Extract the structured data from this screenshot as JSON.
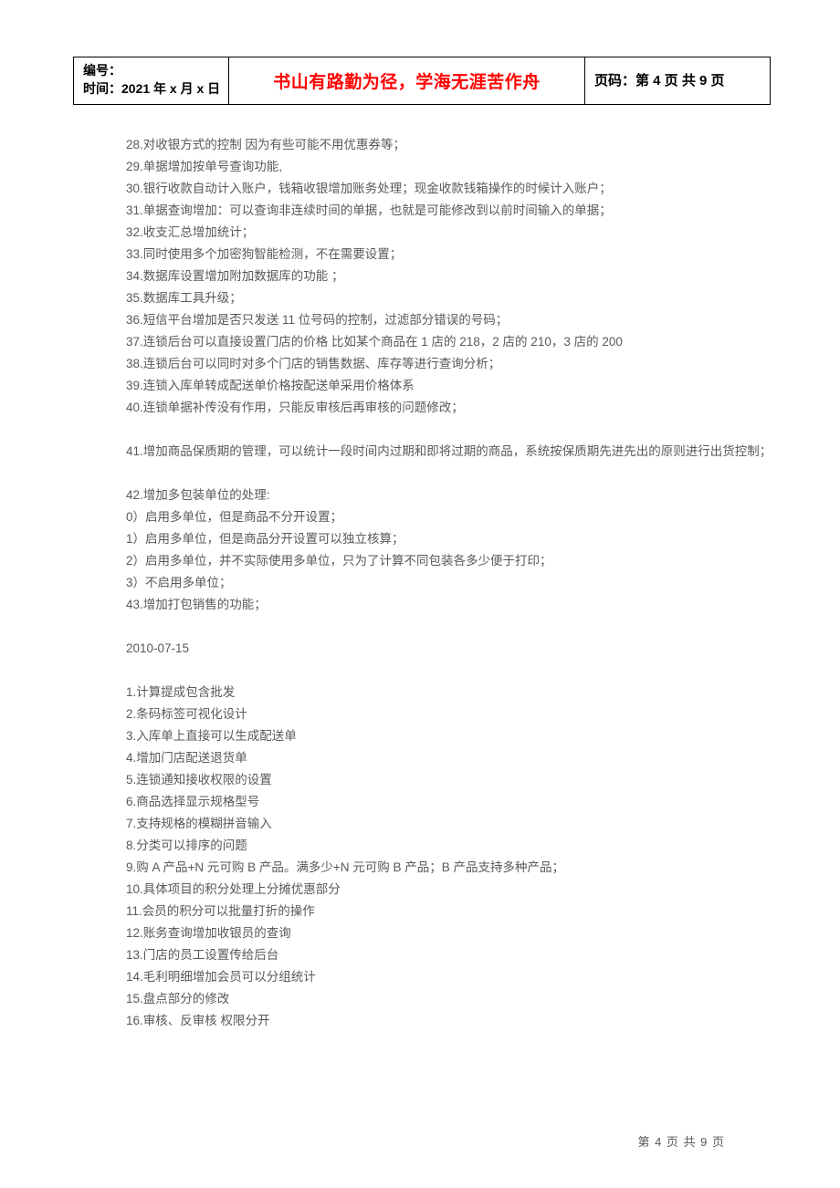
{
  "header": {
    "left_line1": "编号：",
    "left_line2": "时间：2021 年 x 月 x 日",
    "center": "书山有路勤为径，学海无涯苦作舟",
    "right": "页码：第 4 页  共 9 页"
  },
  "sections": [
    {
      "lines": [
        "28.对收银方式的控制  因为有些可能不用优惠券等；",
        "29.单据增加按单号查询功能,",
        "30.银行收款自动计入账户，钱箱收银增加账务处理；现金收款钱箱操作的时候计入账户；",
        "31.单据查询增加：可以查询非连续时间的单据，也就是可能修改到以前时间输入的单据；",
        "32.收支汇总增加统计；",
        "33.同时使用多个加密狗智能检测，不在需要设置；",
        "34.数据库设置增加附加数据库的功能  ；",
        "35.数据库工具升级；",
        "36.短信平台增加是否只发送 11 位号码的控制，过滤部分错误的号码；",
        "37.连锁后台可以直接设置门店的价格  比如某个商品在 1 店的 218，2 店的 210，3 店的 200",
        "38.连锁后台可以同时对多个门店的销售数据、库存等进行查询分析；",
        "39.连锁入库单转成配送单价格按配送单采用价格体系",
        "40.连锁单据补传没有作用，只能反审核后再审核的问题修改；"
      ]
    },
    {
      "lines": [
        "41.增加商品保质期的管理，可以统计一段时间内过期和即将过期的商品，系统按保质期先进先出的原则进行出货控制；"
      ]
    },
    {
      "lines": [
        "42.增加多包装单位的处理:",
        "0）启用多单位，但是商品不分开设置；",
        "1）启用多单位，但是商品分开设置可以独立核算；",
        "2）启用多单位，并不实际使用多单位，只为了计算不同包装各多少便于打印；",
        "3）不启用多单位；",
        "43.增加打包销售的功能；"
      ]
    },
    {
      "lines": [
        "2010-07-15"
      ]
    },
    {
      "lines": [
        "1.计算提成包含批发",
        "2.条码标签可视化设计",
        "3.入库单上直接可以生成配送单",
        "4.增加门店配送退货单",
        "5.连锁通知接收权限的设置",
        "6.商品选择显示规格型号",
        "7.支持规格的模糊拼音输入",
        "8.分类可以排序的问题",
        "9.购 A 产品+N 元可购 B 产品。满多少+N 元可购 B 产品；B 产品支持多种产品；",
        "10.具体项目的积分处理上分摊优惠部分",
        "11.会员的积分可以批量打折的操作",
        "12.账务查询增加收银员的查询",
        "13.门店的员工设置传给后台",
        "14.毛利明细增加会员可以分组统计",
        "15.盘点部分的修改",
        "16.审核、反审核  权限分开"
      ]
    }
  ],
  "footer": "第  4  页  共  9  页"
}
